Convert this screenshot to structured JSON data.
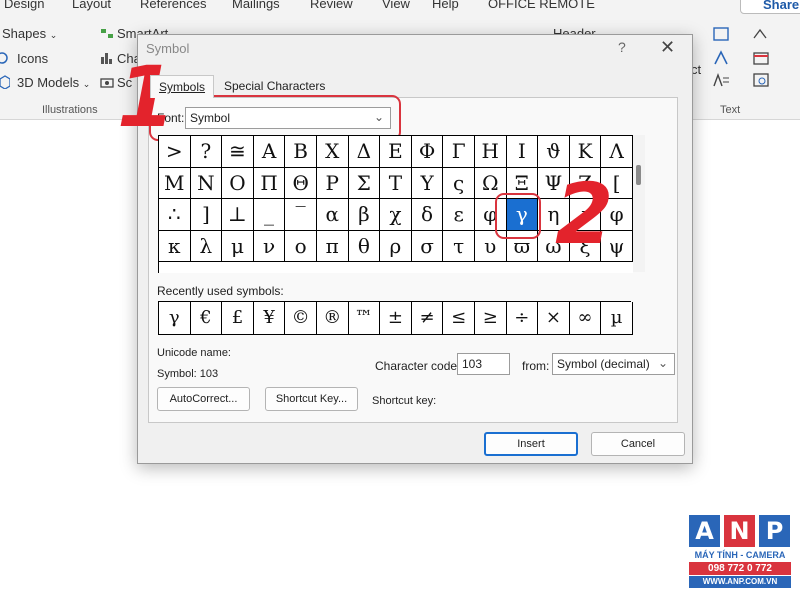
{
  "ribbon": {
    "menu": [
      "Design",
      "Layout",
      "References",
      "Mailings",
      "Review",
      "View",
      "Help",
      "OFFICE REMOTE"
    ],
    "share": "Share",
    "items": {
      "shapes": "Shapes",
      "icons": "Icons",
      "models": "3D Models",
      "smartart": "SmartArt",
      "chart": "Cha",
      "screenshot": "Sc",
      "header": "Header",
      "cut": "ct"
    },
    "groups": {
      "illustrations": "Illustrations",
      "text": "Text"
    }
  },
  "dialog": {
    "title": "Symbol",
    "help": "?",
    "close": "✕",
    "tabs": [
      {
        "label": "Symbols",
        "active": true
      },
      {
        "label": "Special Characters",
        "active": false
      }
    ],
    "font_label": "Font:",
    "font_value": "Symbol",
    "grid": [
      [
        ">",
        "?",
        "≅",
        "Α",
        "Β",
        "Χ",
        "Δ",
        "Ε",
        "Φ",
        "Γ",
        "Η",
        "Ι",
        "ϑ",
        "Κ",
        "Λ"
      ],
      [
        "Μ",
        "Ν",
        "Ο",
        "Π",
        "Θ",
        "Ρ",
        "Σ",
        "Τ",
        "Υ",
        "ς",
        "Ω",
        "Ξ",
        "Ψ",
        "Ζ",
        "["
      ],
      [
        "∴",
        "]",
        "⊥",
        "_",
        "‾",
        "α",
        "β",
        "χ",
        "δ",
        "ε",
        "φ",
        "γ",
        "η",
        "ι",
        "φ"
      ],
      [
        "κ",
        "λ",
        "μ",
        "ν",
        "ο",
        "π",
        "θ",
        "ρ",
        "σ",
        "τ",
        "υ",
        "ϖ",
        "ω",
        "ξ",
        "ψ"
      ]
    ],
    "selected": {
      "row": 2,
      "col": 11
    },
    "recent_label": "Recently used symbols:",
    "recent": [
      "γ",
      "€",
      "£",
      "¥",
      "©",
      "®",
      "™",
      "±",
      "≠",
      "≤",
      "≥",
      "÷",
      "×",
      "∞",
      "µ"
    ],
    "unicode_name_label": "Unicode name:",
    "symbol_code": "Symbol: 103",
    "char_code_label": "Character code:",
    "char_code_value": "103",
    "from_label": "from:",
    "from_value": "Symbol (decimal)",
    "autocorrect_label": "AutoCorrect...",
    "shortcut_key_button": "Shortcut Key...",
    "shortcut_key_label": "Shortcut key:",
    "insert_label": "Insert",
    "cancel_label": "Cancel"
  },
  "annotations": {
    "step1": "1",
    "step2": "2"
  },
  "logo": {
    "letters": [
      "A",
      "N",
      "P"
    ],
    "colors": [
      "#2a66b8",
      "#d9343e",
      "#2a66b8"
    ],
    "tagline": "MÁY TÍNH - CAMERA",
    "phone": "098 772 0 772",
    "website": "WWW.ANP.COM.VN"
  }
}
